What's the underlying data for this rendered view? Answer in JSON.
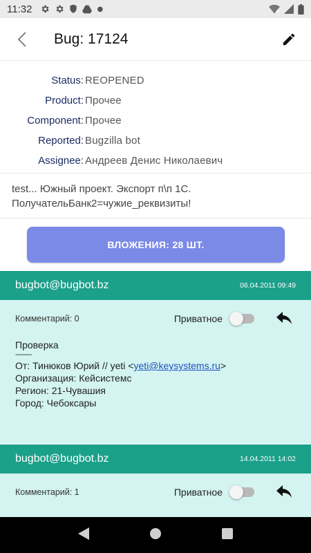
{
  "status_bar": {
    "time": "11:32"
  },
  "app_bar": {
    "title": "Bug: 17124"
  },
  "info": {
    "rows": [
      {
        "label": "Status:",
        "value": "REOPENED"
      },
      {
        "label": "Product:",
        "value": "Прочее"
      },
      {
        "label": "Component:",
        "value": "Прочее"
      },
      {
        "label": "Reported:",
        "value": "Bugzilla bot"
      },
      {
        "label": "Assignee:",
        "value": "Андреев Денис Николаевич"
      }
    ]
  },
  "summary": {
    "line1": "test... Южный проект. Экспорт п\\п 1С.",
    "line2": "ПолучательБанк2=чужие_реквизиты!"
  },
  "attachments_button": "ВЛОЖЕНИЯ: 28 ШТ.",
  "comments": [
    {
      "author": "bugbot@bugbot.bz",
      "date": "06.04.2011 09:49",
      "number": "Комментарий: 0",
      "private_label": "Приватное",
      "private": false,
      "title": "Проверка",
      "separator": "----------",
      "from_prefix": "От: Тинюков Юрий // yeti <",
      "email": "yeti@keysystems.ru",
      "from_suffix": ">",
      "org": "Организация: Кейсистемс",
      "region": "Регион: 21-Чувашия",
      "city": "Город: Чебоксары"
    },
    {
      "author": "bugbot@bugbot.bz",
      "date": "14.04.2011 14:02",
      "number": "Комментарий: 1",
      "private_label": "Приватное",
      "private": false
    }
  ]
}
